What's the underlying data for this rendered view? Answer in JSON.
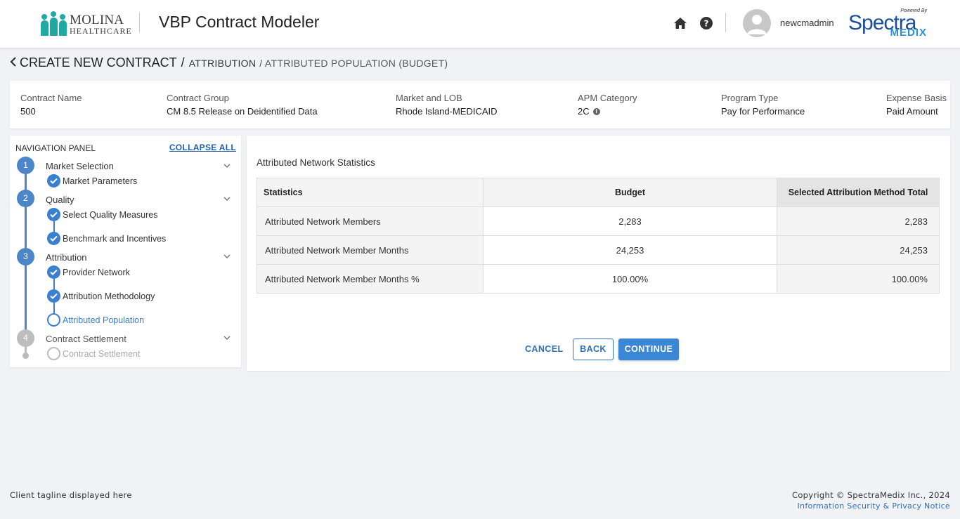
{
  "header": {
    "logo_line1": "MOLINA",
    "logo_line2": "HEALTHCARE",
    "app_title": "VBP Contract Modeler",
    "username": "newcmadmin",
    "vendor_powered": "Powered By",
    "vendor_name": "Spectra",
    "vendor_suffix": "MEDIX",
    "icons": [
      "home-icon",
      "help-icon",
      "avatar"
    ]
  },
  "breadcrumb": {
    "main": "CREATE NEW CONTRACT",
    "sep": "/",
    "step": "ATTRIBUTION",
    "sub": "/ ATTRIBUTED POPULATION (BUDGET)"
  },
  "contract": {
    "name_label": "Contract Name",
    "name_value": "500",
    "group_label": "Contract Group",
    "group_value": "CM 8.5 Release on Deidentified Data",
    "market_label": "Market and LOB",
    "market_value": "Rhode Island-MEDICAID",
    "apm_label": "APM Category",
    "apm_value": "2C",
    "program_label": "Program Type",
    "program_value": "Pay for Performance",
    "expense_label": "Expense Basis",
    "expense_value": "Paid Amount"
  },
  "nav": {
    "title": "NAVIGATION PANEL",
    "collapse_all": "COLLAPSE ALL",
    "steps": [
      {
        "number": "1",
        "label": "Market Selection",
        "state": "done",
        "subs": [
          {
            "label": "Market Parameters",
            "state": "done"
          }
        ]
      },
      {
        "number": "2",
        "label": "Quality",
        "state": "done",
        "subs": [
          {
            "label": "Select Quality Measures",
            "state": "done"
          },
          {
            "label": "Benchmark and Incentives",
            "state": "done"
          }
        ]
      },
      {
        "number": "3",
        "label": "Attribution",
        "state": "active",
        "subs": [
          {
            "label": "Provider Network",
            "state": "done"
          },
          {
            "label": "Attribution Methodology",
            "state": "done"
          },
          {
            "label": "Attributed Population",
            "state": "active"
          }
        ]
      },
      {
        "number": "4",
        "label": "Contract Settlement",
        "state": "pending",
        "subs": [
          {
            "label": "Contract Settlement",
            "state": "disabled"
          }
        ]
      }
    ]
  },
  "main": {
    "title": "Attributed Network Statistics",
    "table": {
      "headers": [
        "Statistics",
        "Budget",
        "Selected Attribution Method Total"
      ],
      "rows": [
        [
          "Attributed Network Members",
          "2,283",
          "2,283"
        ],
        [
          "Attributed Network Member Months",
          "24,253",
          "24,253"
        ],
        [
          "Attributed Network Member Months %",
          "100.00%",
          "100.00%"
        ]
      ]
    },
    "buttons": {
      "cancel": "CANCEL",
      "back": "BACK",
      "continue": "CONTINUE"
    }
  },
  "footer": {
    "tagline": "Client tagline displayed here",
    "copyright": "Copyright © SpectraMedix Inc., 2024",
    "privacy": "Information Security & Privacy Notice"
  },
  "colors": {
    "accent": "#3a87d6",
    "step_blue": "#4a86c8",
    "pending_grey": "#bdbdbd",
    "link_blue": "#2f6fb8",
    "brand_teal": "#1fa9a3",
    "vendor_blue": "#1b4f9c"
  }
}
